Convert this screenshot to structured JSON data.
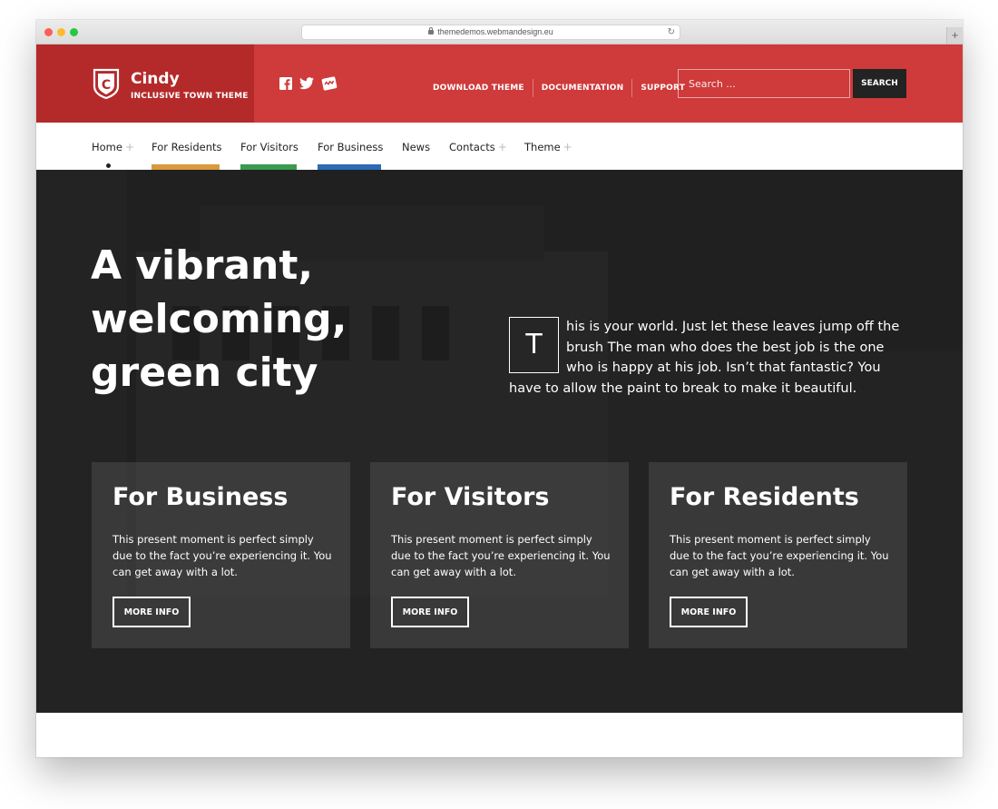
{
  "browser": {
    "url": "themedemos.webmandesign.eu",
    "new_tab_label": "+"
  },
  "header": {
    "logo_letter": "C",
    "site_name": "Cindy",
    "tagline": "INCLUSIVE TOWN THEME",
    "social_icons": [
      "facebook-icon",
      "twitter-icon",
      "webmandesign-icon"
    ],
    "links": [
      "DOWNLOAD THEME",
      "DOCUMENTATION",
      "SUPPORT"
    ],
    "search": {
      "placeholder": "Search ...",
      "button_label": "SEARCH"
    },
    "brand_color": "#cf3a3a",
    "brand_dark_color": "#b42a2a"
  },
  "nav": {
    "items": [
      {
        "label": "Home",
        "has_submenu": true,
        "active": true
      },
      {
        "label": "For Residents",
        "has_submenu": false,
        "accent": "#d99a3e"
      },
      {
        "label": "For Visitors",
        "has_submenu": false,
        "accent": "#3a9a4e"
      },
      {
        "label": "For Business",
        "has_submenu": false,
        "accent": "#2c6bb5"
      },
      {
        "label": "News",
        "has_submenu": false
      },
      {
        "label": "Contacts",
        "has_submenu": true
      },
      {
        "label": "Theme",
        "has_submenu": true
      }
    ],
    "submenu_symbol": "+"
  },
  "hero": {
    "title": "A vibrant, welcoming, green city",
    "dropcap": "T",
    "text": "his is your world. Just let these leaves jump off the brush The man who does the best job is the one who is happy at his job. Isn’t that fantastic? You have to allow the paint to break to make it beautiful.",
    "cards": [
      {
        "title": "For Business",
        "text": "This present moment is perfect simply due to the fact you’re experiencing it. You can get away with a lot.",
        "button": "MORE INFO"
      },
      {
        "title": "For Visitors",
        "text": "This present moment is perfect simply due to the fact you’re experiencing it. You can get away with a lot.",
        "button": "MORE INFO"
      },
      {
        "title": "For Residents",
        "text": "This present moment is perfect simply due to the fact you’re experiencing it. You can get away with a lot.",
        "button": "MORE INFO"
      }
    ]
  }
}
